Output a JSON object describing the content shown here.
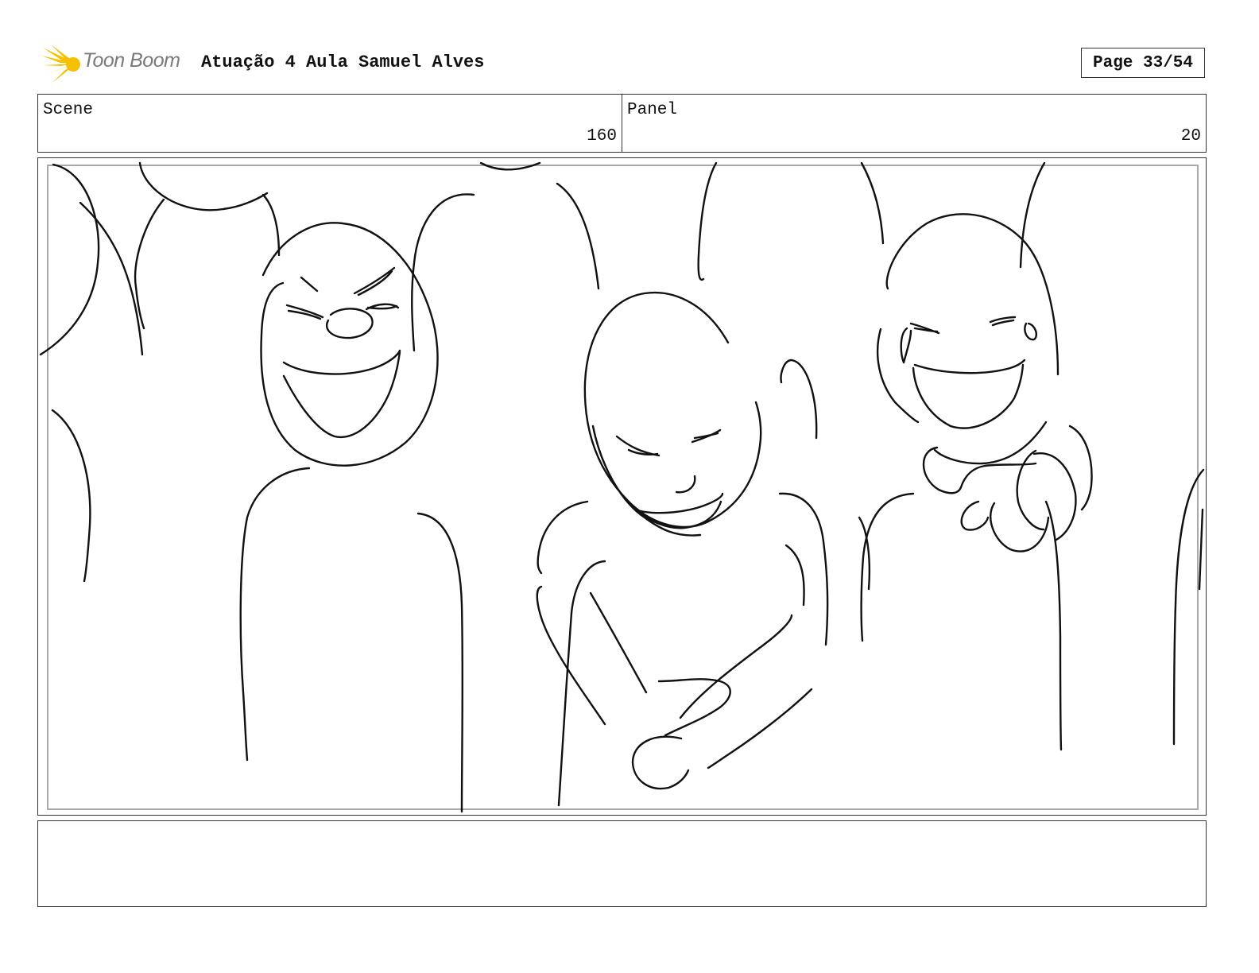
{
  "header": {
    "logo_text": "Toon Boom",
    "title": "Atuação 4 Aula Samuel Alves",
    "page": "Page 33/54"
  },
  "info": {
    "scene_label": "Scene",
    "scene_value": "160",
    "panel_label": "Panel",
    "panel_value": "20"
  },
  "notes": {
    "text": ""
  },
  "colors": {
    "logo_star": "#f5c000",
    "logo_text": "#7a7a7a",
    "frame_inner": "#a8a8a8",
    "border": "#333333"
  }
}
